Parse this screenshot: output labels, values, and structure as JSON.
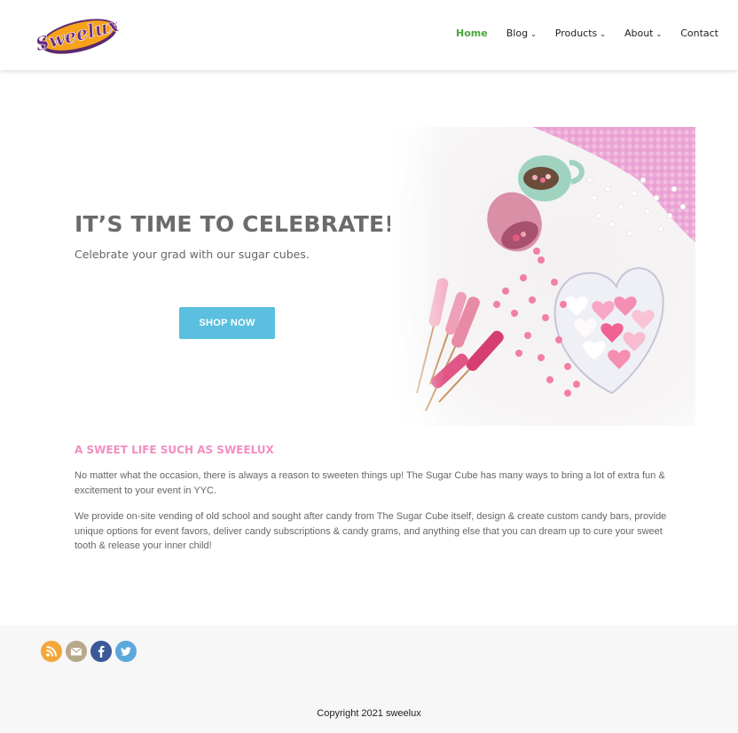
{
  "header": {
    "logo_text": "Sweelux",
    "nav": [
      {
        "label": "Home",
        "active": true,
        "has_dropdown": false
      },
      {
        "label": "Blog",
        "active": false,
        "has_dropdown": true
      },
      {
        "label": "Products",
        "active": false,
        "has_dropdown": true
      },
      {
        "label": "About",
        "active": false,
        "has_dropdown": true
      },
      {
        "label": "Contact",
        "active": false,
        "has_dropdown": false
      }
    ],
    "dropdown_glyph": "⌄"
  },
  "hero": {
    "title": "IT’S TIME TO CELEBRATE!",
    "subtitle": "Celebrate your grad with our sugar cubes.",
    "cta_label": "SHOP NOW",
    "image_icon": "candy-photo"
  },
  "content": {
    "heading": "A SWEET LIFE SUCH AS SWEELUX",
    "paragraph_1": "No matter what the occasion, there is always a reason to sweeten things up! The Sugar Cube has many ways to bring a lot of extra fun & excitement to your event in YYC.",
    "paragraph_2": "We provide on-site vending of old school and sought after candy from The Sugar Cube itself, design & create custom candy bars, provide unique options for event favors, deliver candy subscriptions & candy grams, and anything else that you can dream up to cure your sweet tooth & release your inner child!"
  },
  "footer": {
    "social": [
      {
        "icon": "rss-icon",
        "color": "#f5a63a"
      },
      {
        "icon": "email-icon",
        "color": "#b8a98c"
      },
      {
        "icon": "facebook-icon",
        "color": "#3b5998"
      },
      {
        "icon": "twitter-icon",
        "color": "#5aa9dc"
      }
    ],
    "copyright": "Copyright 2021 sweelux"
  },
  "colors": {
    "accent_green": "#4aa63a",
    "button_blue": "#5bbfdf",
    "heading_pink": "#f28ec2",
    "footer_bg": "#f7f7f7"
  }
}
